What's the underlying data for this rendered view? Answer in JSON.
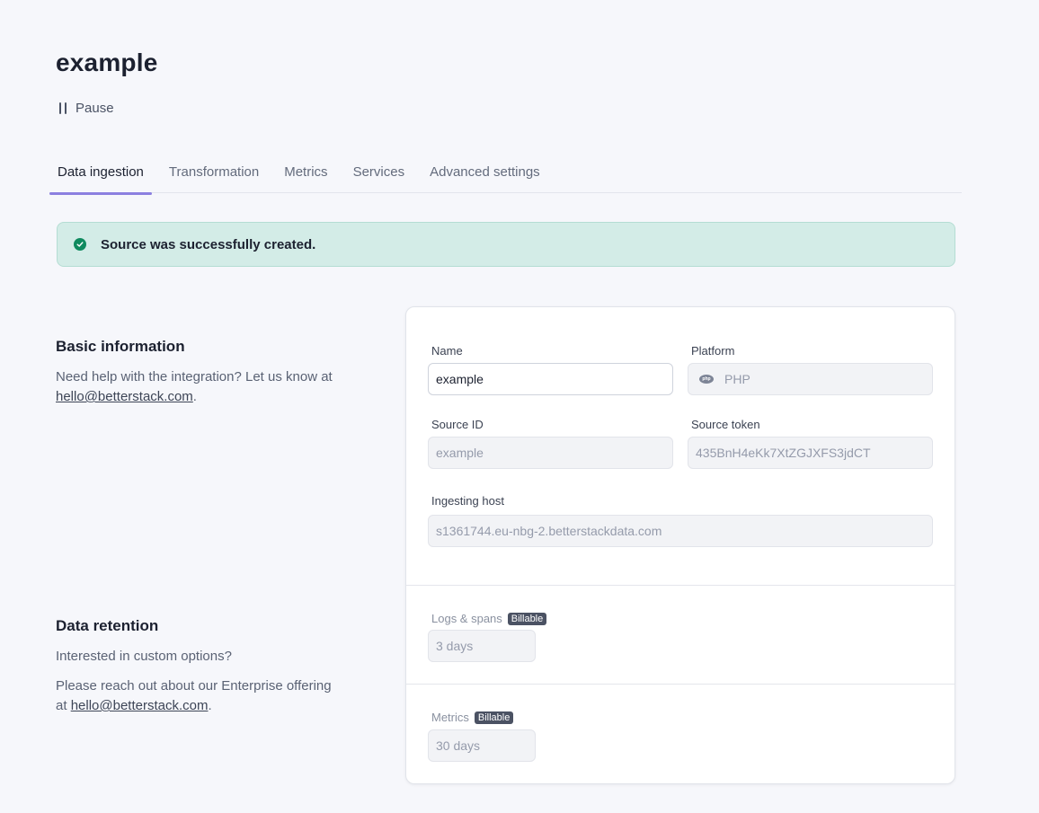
{
  "page": {
    "title": "example"
  },
  "actions": {
    "pause_label": "Pause"
  },
  "tabs": [
    {
      "label": "Data ingestion"
    },
    {
      "label": "Transformation"
    },
    {
      "label": "Metrics"
    },
    {
      "label": "Services"
    },
    {
      "label": "Advanced settings"
    }
  ],
  "alert": {
    "message": "Source was successfully created."
  },
  "basic_info": {
    "title": "Basic information",
    "desc_line1": "Need help with the integration? Let us know at",
    "email": "hello@betterstack.com",
    "suffix": "."
  },
  "retention": {
    "title": "Data retention",
    "desc1": "Interested in custom options?",
    "desc2": "Please reach out about our Enterprise offering at",
    "email": "hello@betterstack.com",
    "suffix": "."
  },
  "form": {
    "name_label": "Name",
    "name_value": "example",
    "platform_label": "Platform",
    "platform_value": "PHP",
    "platform_icon_text": "php",
    "source_id_label": "Source ID",
    "source_id_value": "example",
    "source_token_label": "Source token",
    "source_token_value": "435BnH4eKk7XtZGJXFS3jdCT",
    "host_label": "Ingesting host",
    "host_value": "s1361744.eu-nbg-2.betterstackdata.com",
    "logs_label": "Logs & spans",
    "logs_badge": "Billable",
    "logs_value": "3 days",
    "metrics_label": "Metrics",
    "metrics_badge": "Billable",
    "metrics_value": "30 days"
  },
  "colors": {
    "accent": "#8b80e0",
    "success_bg": "#d3ece7",
    "success_icon": "#0f8a5f",
    "badge_bg": "#4b5263"
  }
}
